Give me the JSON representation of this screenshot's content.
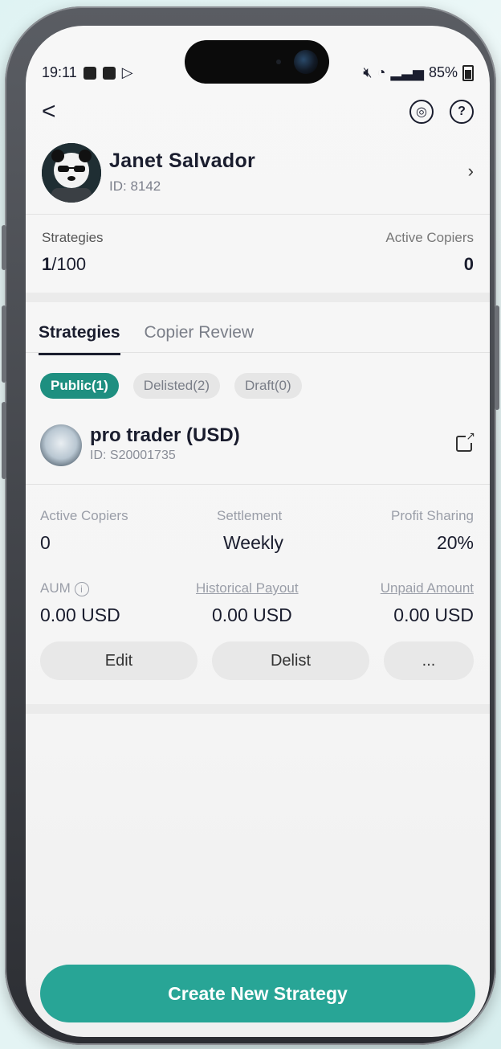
{
  "status_bar": {
    "time": "19:11",
    "battery": "85%"
  },
  "header": {
    "back_label": "<",
    "support_icon": "support-icon",
    "help_icon": "help-icon"
  },
  "profile": {
    "name": "Janet Salvador",
    "id": "ID: 8142"
  },
  "summary": {
    "strategies_label": "Strategies",
    "strategies_count": "1",
    "strategies_total": "/100",
    "active_copiers_label": "Active Copiers",
    "active_copiers_value": "0"
  },
  "tabs": [
    {
      "label": "Strategies",
      "active": true
    },
    {
      "label": "Copier Review",
      "active": false
    }
  ],
  "filters": [
    {
      "label": "Public(1)",
      "active": true
    },
    {
      "label": "Delisted(2)",
      "active": false
    },
    {
      "label": "Draft(0)",
      "active": false
    }
  ],
  "strategy": {
    "name": "pro trader (USD)",
    "id": "ID: S20001735",
    "active_copiers_label": "Active Copiers",
    "active_copiers_value": "0",
    "settlement_label": "Settlement",
    "settlement_value": "Weekly",
    "profit_sharing_label": "Profit Sharing",
    "profit_sharing_value": "20%",
    "aum_label": "AUM",
    "aum_value": "0.00 USD",
    "historical_payout_label": "Historical Payout",
    "historical_payout_value": "0.00 USD",
    "unpaid_amount_label": "Unpaid Amount",
    "unpaid_amount_value": "0.00 USD",
    "edit_label": "Edit",
    "delist_label": "Delist",
    "more_label": "..."
  },
  "cta": {
    "label": "Create New Strategy"
  },
  "colors": {
    "accent": "#28a596",
    "pill_active": "#1e8f80"
  }
}
